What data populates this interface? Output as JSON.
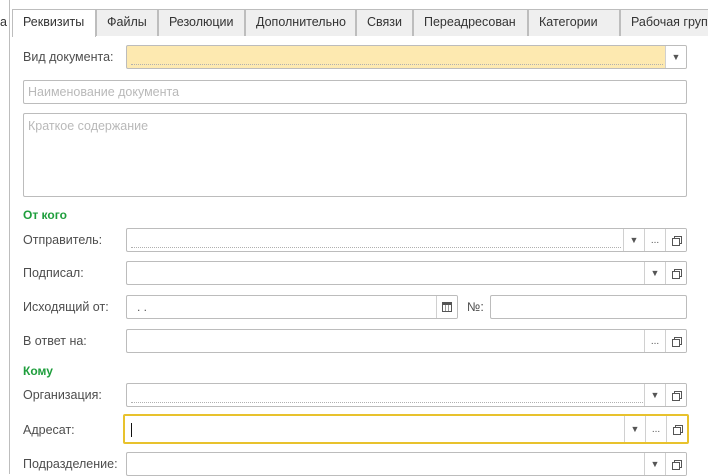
{
  "clipped_left_char": "а",
  "tabs": [
    {
      "label": "Реквизиты",
      "active": true
    },
    {
      "label": "Файлы",
      "active": false
    },
    {
      "label": "Резолюции",
      "active": false
    },
    {
      "label": "Дополнительно",
      "active": false
    },
    {
      "label": "Связи",
      "active": false
    },
    {
      "label": "Переадресован",
      "active": false
    },
    {
      "label": "Категории",
      "active": false
    },
    {
      "label": "Рабочая групп",
      "active": false
    }
  ],
  "form": {
    "doc_type_label": "Вид документа:",
    "doc_name_placeholder": "Наименование документа",
    "summary_placeholder": "Краткое содержание",
    "from_section": "От кого",
    "sender_label": "Отправитель:",
    "signed_label": "Подписал:",
    "outgoing_label": "Исходящий от:",
    "outgoing_date_value": " .  .",
    "number_label": "№:",
    "reply_to_label": "В ответ на:",
    "to_section": "Кому",
    "organization_label": "Организация:",
    "addressee_label": "Адресат:",
    "department_label": "Подразделение:"
  },
  "icons": {
    "dropdown": "chevron-down-icon",
    "select": "ellipsis-icon",
    "open": "open-form-icon",
    "calendar": "calendar-icon"
  },
  "colors": {
    "section_header": "#1e9e3c",
    "required_field": "#fde9b0",
    "focus_border": "#e8c22d"
  }
}
